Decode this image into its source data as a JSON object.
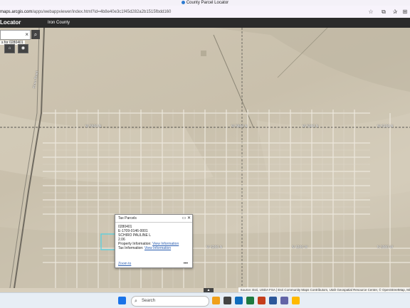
{
  "window": {
    "title": "County Parcel Locator"
  },
  "browser": {
    "url_domain": "maps.arcgis.com",
    "url_path": "/apps/webappviewer/index.html?id=4b8e40e3c1f45d282a2b1515fbdd160",
    "icons": [
      "star-icon",
      "extensions-icon",
      "favorites-icon",
      "collections-icon"
    ]
  },
  "app": {
    "title": "Locator",
    "subtitle": "Iron County"
  },
  "search": {
    "value": "",
    "clear_glyph": "×",
    "hint": "s for 0280401"
  },
  "map": {
    "road_labels": [
      "Elmo Road",
      "W 5500 N",
      "W 5800 N",
      "W 5900 N",
      "W 6100 N",
      "W 6200 N",
      "N 4200 W",
      "N 3900 W"
    ]
  },
  "popup": {
    "title": "Tax Parcels",
    "parcel_id": "0280401",
    "serial": "E-1709-0146-0001",
    "owner": "SCHIRO PAULINE L",
    "acres": "2.06",
    "property_info_label": "Property Information:",
    "property_info_link": "View Information",
    "tax_info_label": "Tax Information:",
    "tax_info_link": "View Information",
    "zoom_to": "Zoom to",
    "more": "•••"
  },
  "attribution": "Source: Esri, USDA FSA | Esri Community Maps Contributors, Utah Geospatial Resource Center, © OpenStreetMap, Mi",
  "taskbar": {
    "search_label": "Search"
  }
}
